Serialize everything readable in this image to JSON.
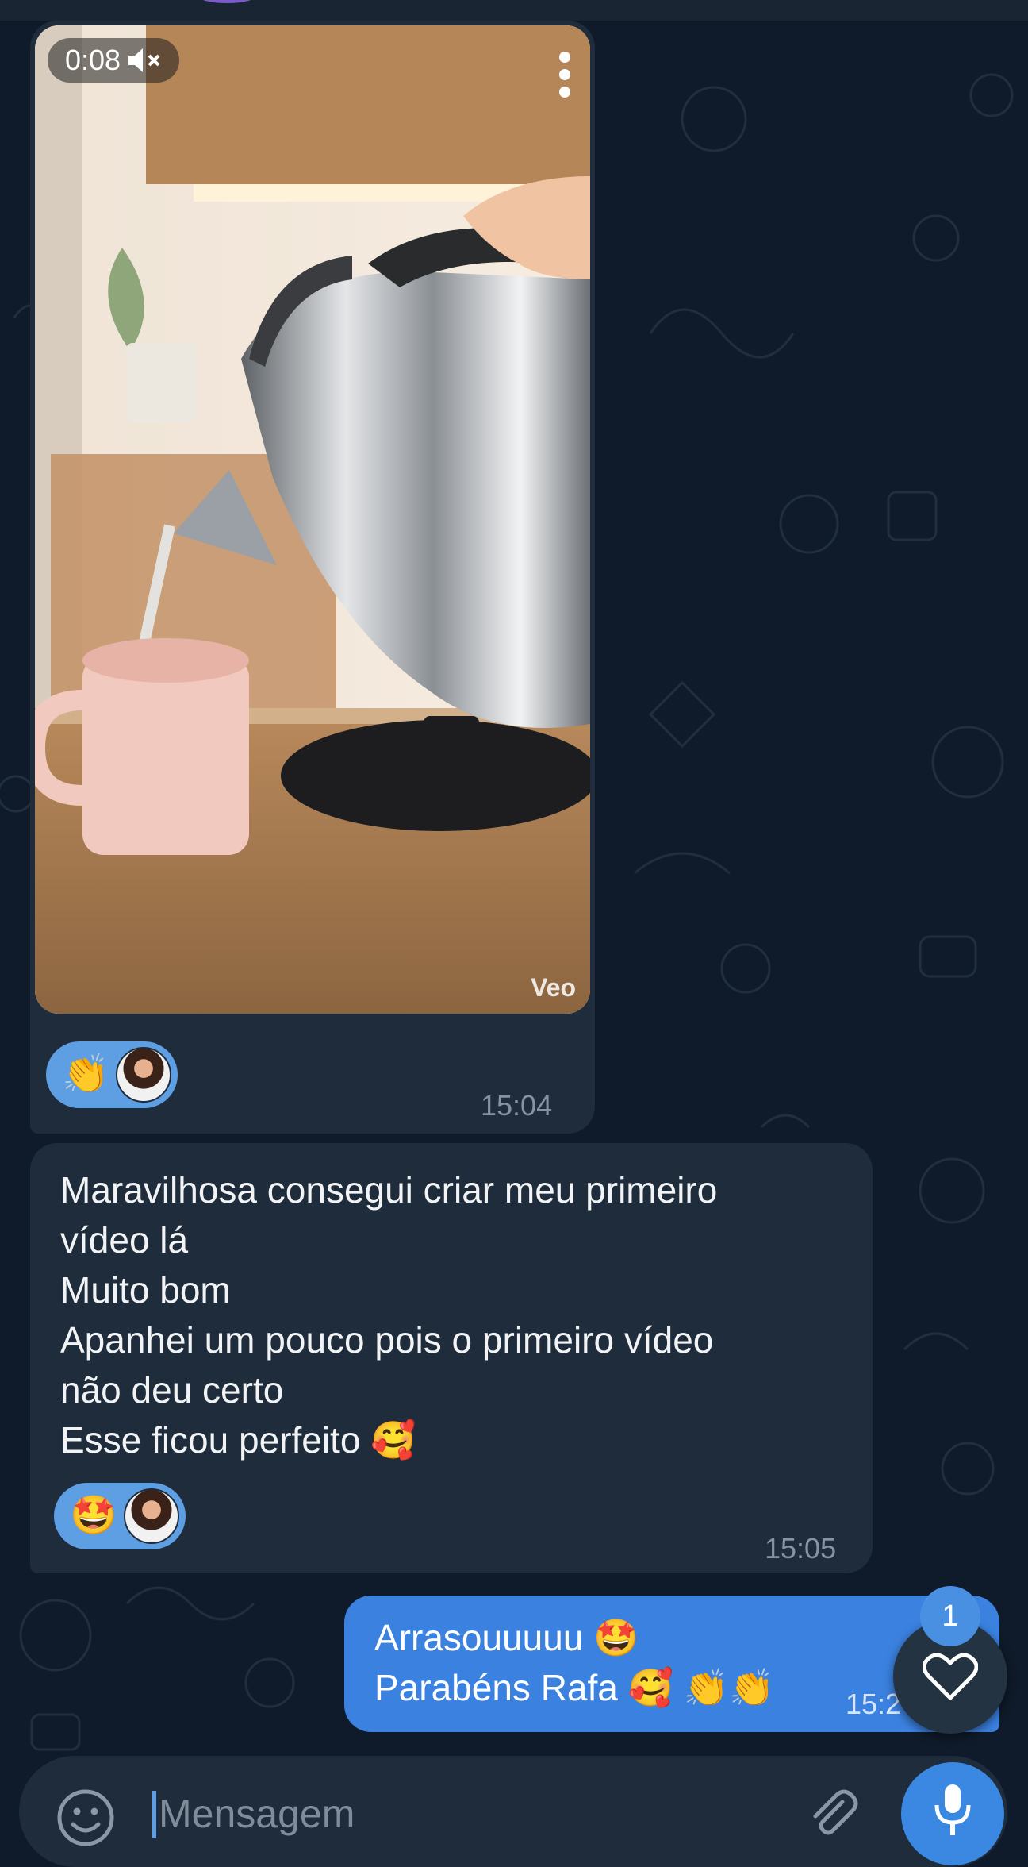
{
  "colors": {
    "background": "#0f1b2a",
    "incoming_bubble": "#1f2c3b",
    "outgoing_bubble": "#3b82e0",
    "reaction_pill": "#5e9ee3",
    "accent": "#3b88e3"
  },
  "video_message": {
    "duration": "0:08",
    "muted_icon": "mute-icon",
    "more_icon": "more-vertical-icon",
    "watermark": "Veo",
    "reaction_emoji": "👏",
    "time": "15:04"
  },
  "text_message": {
    "lines": [
      "Maravilhosa consegui criar meu primeiro",
      "vídeo lá",
      "Muito bom",
      "Apanhei um pouco pois o primeiro vídeo",
      "não deu certo",
      "Esse ficou perfeito 🥰"
    ],
    "reaction_emoji": "🤩",
    "time": "15:05"
  },
  "outgoing_message": {
    "lines": [
      "Arrasouuuuu 🤩",
      "Parabéns Rafa 🥰 👏👏"
    ],
    "time": "15:2"
  },
  "floating_reaction": {
    "icon": "heart-icon",
    "badge_count": "1"
  },
  "composer": {
    "placeholder": "Mensagem",
    "emoji_icon": "emoji-icon",
    "attach_icon": "paperclip-icon",
    "mic_icon": "microphone-icon"
  }
}
